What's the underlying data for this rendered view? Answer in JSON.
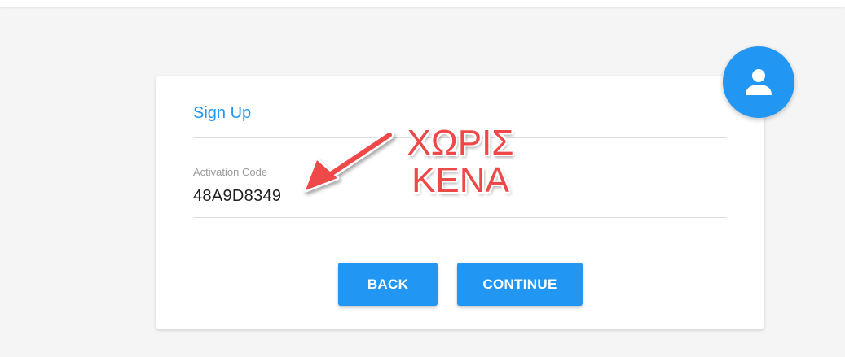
{
  "card": {
    "title": "Sign Up",
    "field_label": "Activation Code",
    "field_value": "48A9D8349",
    "back_label": "BACK",
    "continue_label": "CONTINUE"
  },
  "annotation": {
    "line1": "ΧΩΡΙΣ",
    "line2": "ΚΕΝΑ"
  },
  "icons": {
    "avatar": "user-icon",
    "arrow": "arrow-icon"
  },
  "colors": {
    "accent": "#2196f3",
    "annotation": "#f04848"
  }
}
